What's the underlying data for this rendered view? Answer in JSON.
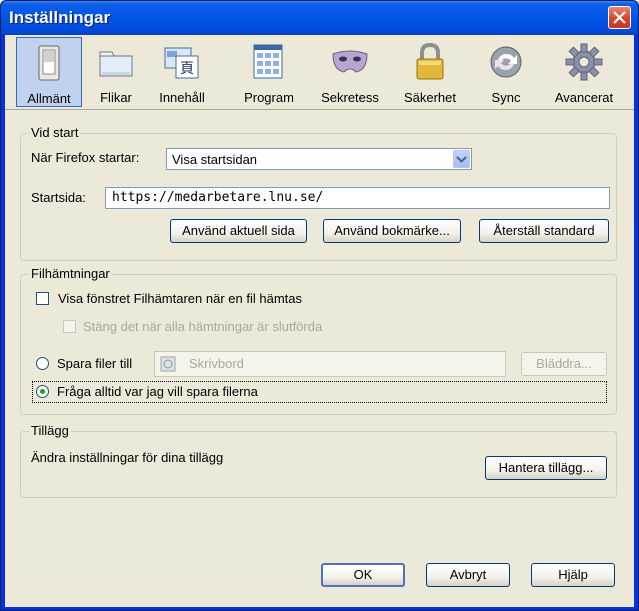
{
  "window": {
    "title": "Inställningar"
  },
  "toolbar": {
    "tabs": [
      {
        "label": "Allmänt",
        "icon": "general-switch-icon",
        "selected": true
      },
      {
        "label": "Flikar",
        "icon": "tabs-icon",
        "selected": false
      },
      {
        "label": "Innehåll",
        "icon": "content-icon",
        "selected": false
      },
      {
        "label": "Program",
        "icon": "applications-icon",
        "selected": false
      },
      {
        "label": "Sekretess",
        "icon": "mask-icon",
        "selected": false
      },
      {
        "label": "Säkerhet",
        "icon": "padlock-icon",
        "selected": false
      },
      {
        "label": "Sync",
        "icon": "sync-icon",
        "selected": false
      },
      {
        "label": "Avancerat",
        "icon": "gear-icon",
        "selected": false
      }
    ]
  },
  "startup": {
    "legend": "Vid start",
    "when_label": "När Firefox startar:",
    "when_value": "Visa startsidan",
    "homepage_label": "Startsida:",
    "homepage_value": "https://medarbetare.lnu.se/",
    "use_current_btn": "Använd aktuell sida",
    "use_bookmark_btn": "Använd bokmärke...",
    "restore_default_btn": "Återställ standard"
  },
  "downloads": {
    "legend": "Filhämtningar",
    "show_window_label": "Visa fönstret Filhämtaren när en fil hämtas",
    "close_when_done_label": "Stäng det när alla hämtningar är slutförda",
    "save_to_label": "Spara filer till",
    "save_to_folder": "Skrivbord",
    "browse_btn": "Bläddra...",
    "always_ask_label": "Fråga alltid var jag vill spara filerna"
  },
  "addons": {
    "legend": "Tillägg",
    "description": "Ändra inställningar för dina tillägg",
    "manage_btn": "Hantera tillägg..."
  },
  "footer": {
    "ok": "OK",
    "cancel": "Avbryt",
    "help": "Hjälp"
  },
  "colors": {
    "titlebar": "#0256e5",
    "client": "#ece9d8",
    "selected_tab": "#c1d2ee",
    "close": "#d6442a"
  }
}
